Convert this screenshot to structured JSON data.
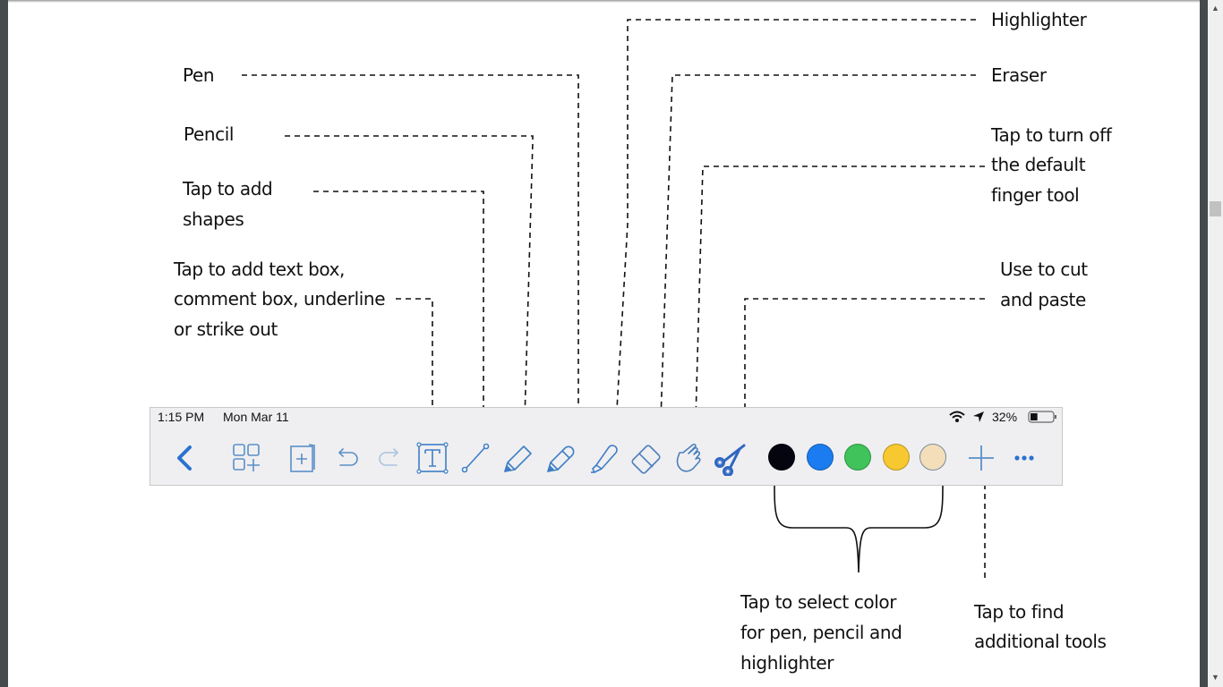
{
  "annotations": {
    "pen": "Pen",
    "pencil": "Pencil",
    "shapes": [
      "Tap to add",
      "shapes"
    ],
    "textbox": [
      "Tap to add text box,",
      "comment box, underline",
      "or strike out"
    ],
    "highlighter": "Highlighter",
    "eraser": "Eraser",
    "finger": [
      "Tap to turn off",
      "the default",
      "finger tool"
    ],
    "cut": [
      "Use to cut",
      "and paste"
    ],
    "color": [
      "Tap to select color",
      "for pen, pencil and",
      "highlighter"
    ],
    "more": [
      "Tap to find",
      "additional tools"
    ]
  },
  "status_bar": {
    "time": "1:15 PM",
    "date": "Mon Mar 11",
    "battery": "32%",
    "battery_level": 0.32,
    "icons": [
      "wifi-icon",
      "location-arrow-icon",
      "battery-icon"
    ]
  },
  "toolbar": {
    "tools": [
      "back",
      "thumbnails",
      "add-page",
      "undo",
      "redo",
      "text",
      "shape-line",
      "pencil",
      "pen",
      "highlighter",
      "eraser",
      "finger",
      "scissors",
      "add-tool",
      "more"
    ],
    "colors": [
      {
        "name": "black",
        "hex": "#050510"
      },
      {
        "name": "blue",
        "hex": "#1a7cf0"
      },
      {
        "name": "green",
        "hex": "#3fc35a"
      },
      {
        "name": "yellow",
        "hex": "#f7c830"
      },
      {
        "name": "beige",
        "hex": "#f3deb9"
      }
    ],
    "accent": "#2f7bd8"
  }
}
